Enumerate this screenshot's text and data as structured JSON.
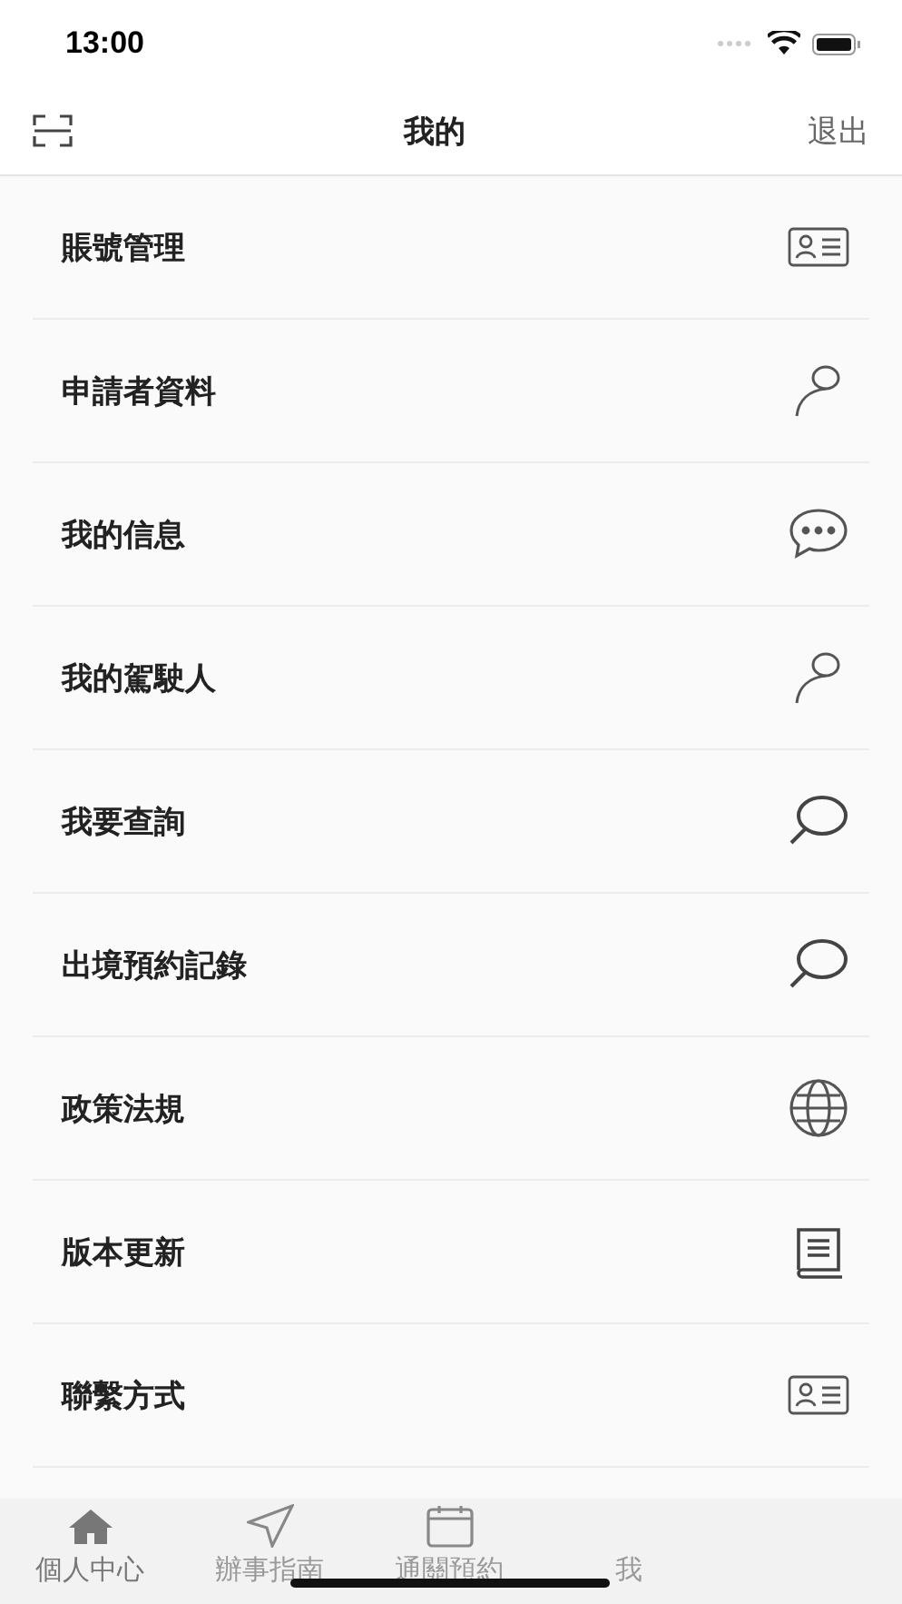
{
  "status_bar": {
    "time": "13:00"
  },
  "nav_bar": {
    "title": "我的",
    "action": "退出"
  },
  "menu": [
    {
      "label": "賬號管理"
    },
    {
      "label": "申請者資料"
    },
    {
      "label": "我的信息"
    },
    {
      "label": "我的駕駛人"
    },
    {
      "label": "我要查詢"
    },
    {
      "label": "出境預約記錄"
    },
    {
      "label": "政策法規"
    },
    {
      "label": "版本更新"
    },
    {
      "label": "聯繫方式"
    }
  ],
  "tab_bar": [
    {
      "label": "個人中心",
      "selected": true
    },
    {
      "label": "辦事指南",
      "selected": false
    },
    {
      "label": "通關預約",
      "selected": false
    },
    {
      "label": "我",
      "selected": false
    }
  ]
}
